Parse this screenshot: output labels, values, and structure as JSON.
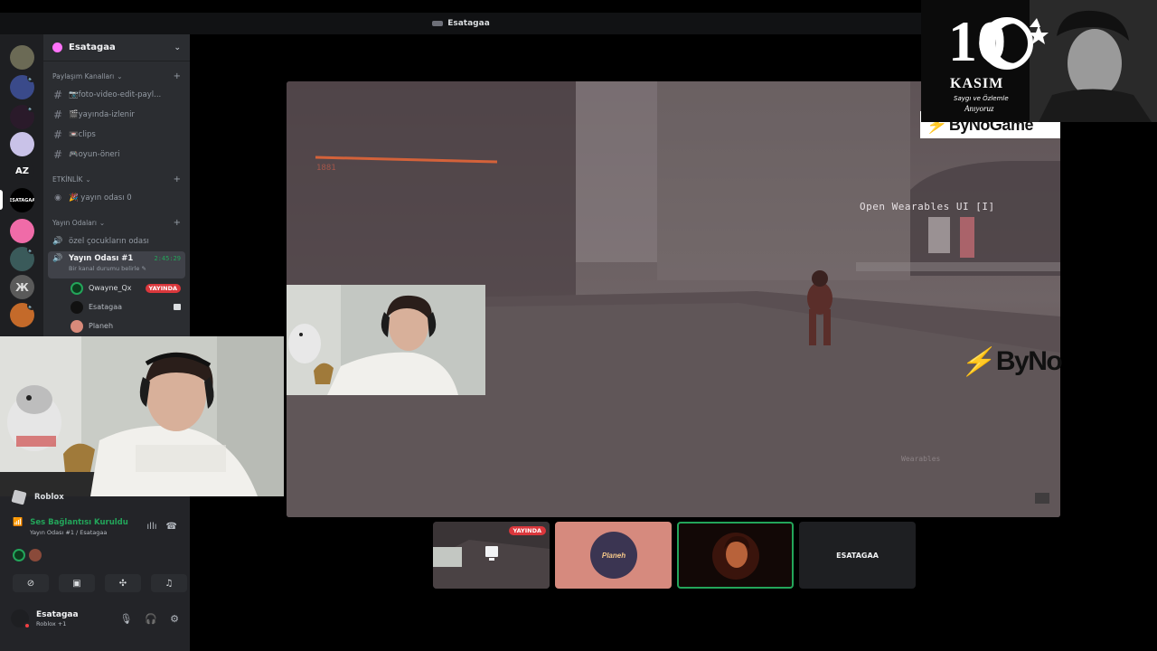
{
  "window": {
    "title": "Esatagaa"
  },
  "guilds": {
    "az_label": "AZ",
    "esatagaa_label": "ESATAGAA"
  },
  "server": {
    "name": "Esatagaa"
  },
  "categories": [
    {
      "name": "Paylaşım Kanalları"
    },
    {
      "name": "ETKİNLİK"
    },
    {
      "name": "Yayın Odaları"
    }
  ],
  "text_channels": [
    {
      "name": "📷foto-video-edit-payl..."
    },
    {
      "name": "🎬yayında-izlenir"
    },
    {
      "name": "📼clips"
    },
    {
      "name": "🎮oyun-öneri"
    }
  ],
  "event_channel": {
    "name": "🎉 yayın odası 0"
  },
  "voice_channels": {
    "private": {
      "name": "özel çocukların odası"
    },
    "active": {
      "name": "Yayın Odası #1",
      "timer": "2:45:29",
      "status": "Bir kanal durumu belirle"
    }
  },
  "members": [
    {
      "name": "Qwayne_Qx",
      "badge": "YAYINDA"
    },
    {
      "name": "Esatagaa"
    },
    {
      "name": "Planeh"
    }
  ],
  "activity": {
    "game": "Roblox"
  },
  "rtc": {
    "status": "Ses Bağlantısı Kuruldu",
    "location": "Yayın Odası #1 / Esatagaa"
  },
  "user": {
    "name": "Esatagaa",
    "status": "Roblox +1"
  },
  "stream": {
    "hud_text": "Open Wearables UI [I]",
    "watermark_brand": "ByNoGame",
    "watermark_brand_short": "ByNo"
  },
  "overlay": {
    "number": "10",
    "month": "KASIM",
    "subtitle": "Saygı ve Özlemle",
    "signature": "Anıyoruz"
  },
  "tiles": [
    {
      "badge": "YAYINDA"
    },
    {
      "name": "Planeh"
    },
    {
      "name": ""
    },
    {
      "name": "ESATAGAA"
    }
  ],
  "colors": {
    "accent_green": "#23a55a",
    "live_red": "#da373c",
    "brand_red": "#d62f2f"
  }
}
